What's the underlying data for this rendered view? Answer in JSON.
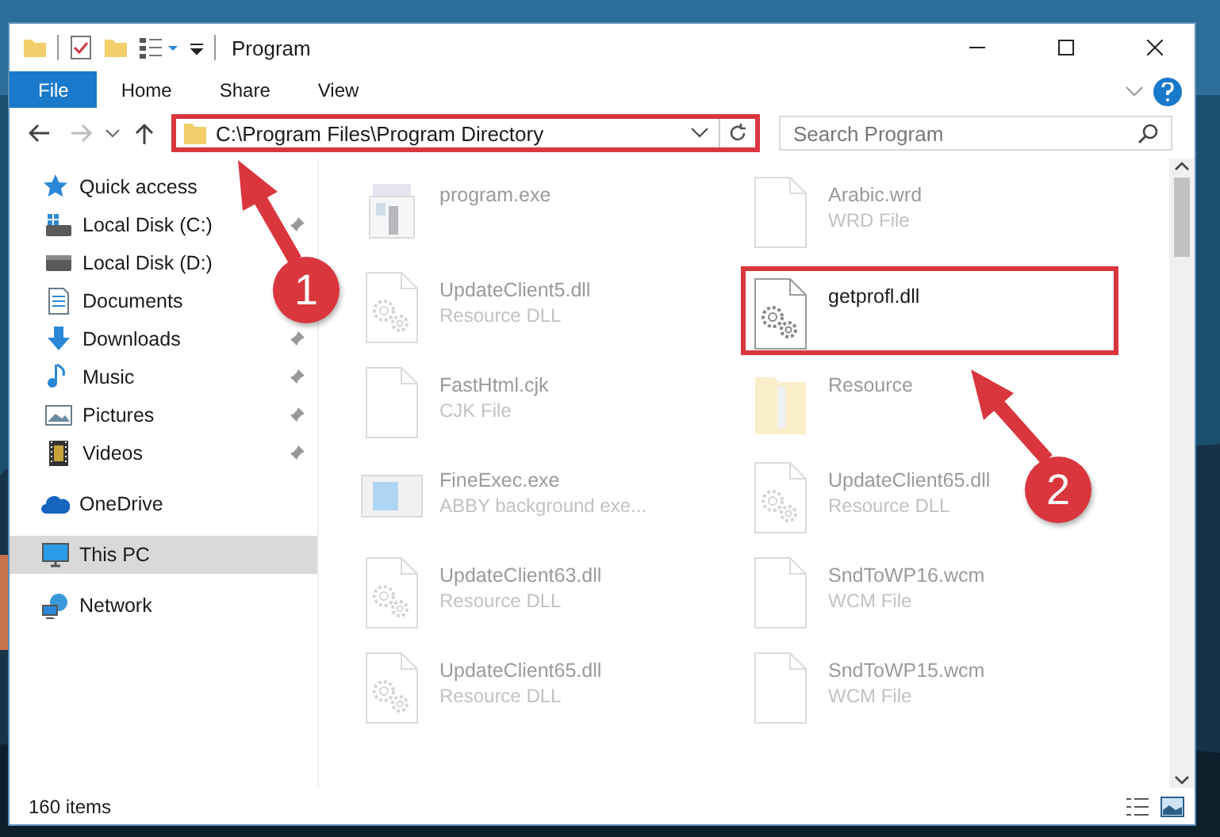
{
  "window": {
    "title": "Program"
  },
  "ribbon": {
    "tabs": [
      {
        "label": "File",
        "kind": "file",
        "selected": false
      },
      {
        "label": "Home",
        "kind": "tab",
        "selected": false
      },
      {
        "label": "Share",
        "kind": "tab",
        "selected": false
      },
      {
        "label": "View",
        "kind": "tab",
        "selected": false
      }
    ]
  },
  "address": {
    "path": "C:\\Program Files\\Program Directory",
    "annotated": true
  },
  "search": {
    "placeholder": "Search Program"
  },
  "sidebar": {
    "items": [
      {
        "label": "Quick access",
        "kind": "star",
        "group": true,
        "pinned": false,
        "selected": false
      },
      {
        "label": "Local Disk (C:)",
        "kind": "disk-c",
        "group": false,
        "pinned": true,
        "selected": false
      },
      {
        "label": "Local Disk (D:)",
        "kind": "disk",
        "group": false,
        "pinned": false,
        "selected": false
      },
      {
        "label": "Documents",
        "kind": "documents",
        "group": false,
        "pinned": false,
        "selected": false
      },
      {
        "label": "Downloads",
        "kind": "download",
        "group": false,
        "pinned": true,
        "selected": false
      },
      {
        "label": "Music",
        "kind": "music",
        "group": false,
        "pinned": true,
        "selected": false
      },
      {
        "label": "Pictures",
        "kind": "pictures",
        "group": false,
        "pinned": true,
        "selected": false
      },
      {
        "label": "Videos",
        "kind": "videos",
        "group": false,
        "pinned": true,
        "selected": false
      },
      {
        "label": "OneDrive",
        "kind": "cloud",
        "group": true,
        "pinned": false,
        "selected": false
      },
      {
        "label": "This PC",
        "kind": "pc",
        "group": true,
        "pinned": false,
        "selected": true
      },
      {
        "label": "Network",
        "kind": "network",
        "group": true,
        "pinned": false,
        "selected": false
      }
    ]
  },
  "files": [
    {
      "name": "program.exe",
      "kind": "installer",
      "faded": true,
      "annotated": false
    },
    {
      "name": "Arabic.wrd",
      "detail": "WRD File",
      "kind": "blank",
      "faded": true,
      "annotated": false
    },
    {
      "name": "UpdateClient5.dll",
      "detail": "Resource DLL",
      "kind": "dll",
      "faded": true,
      "annotated": false
    },
    {
      "name": "getprofl.dll",
      "kind": "dll",
      "faded": false,
      "annotated": true
    },
    {
      "name": "FastHtml.cjk",
      "detail": "CJK File",
      "kind": "blank",
      "faded": true,
      "annotated": false
    },
    {
      "name": "Resource",
      "kind": "folder",
      "faded": true,
      "annotated": false
    },
    {
      "name": "FineExec.exe",
      "detail": "ABBY background exe...",
      "kind": "window",
      "faded": true,
      "annotated": false
    },
    {
      "name": "UpdateClient65.dll",
      "detail": "Resource DLL",
      "kind": "dll",
      "faded": true,
      "annotated": false
    },
    {
      "name": "UpdateClient63.dll",
      "detail": "Resource DLL",
      "kind": "dll",
      "faded": true,
      "annotated": false
    },
    {
      "name": "SndToWP16.wcm",
      "detail": "WCM File",
      "kind": "blank",
      "faded": true,
      "annotated": false
    },
    {
      "name": "UpdateClient65.dll",
      "detail": "Resource DLL",
      "kind": "dll",
      "faded": true,
      "annotated": false
    },
    {
      "name": "SndToWP15.wcm",
      "detail": "WCM File",
      "kind": "blank",
      "faded": true,
      "annotated": false
    }
  ],
  "annotations": [
    {
      "label": "1"
    },
    {
      "label": "2"
    }
  ],
  "status_bar": {
    "count": "160 items"
  }
}
